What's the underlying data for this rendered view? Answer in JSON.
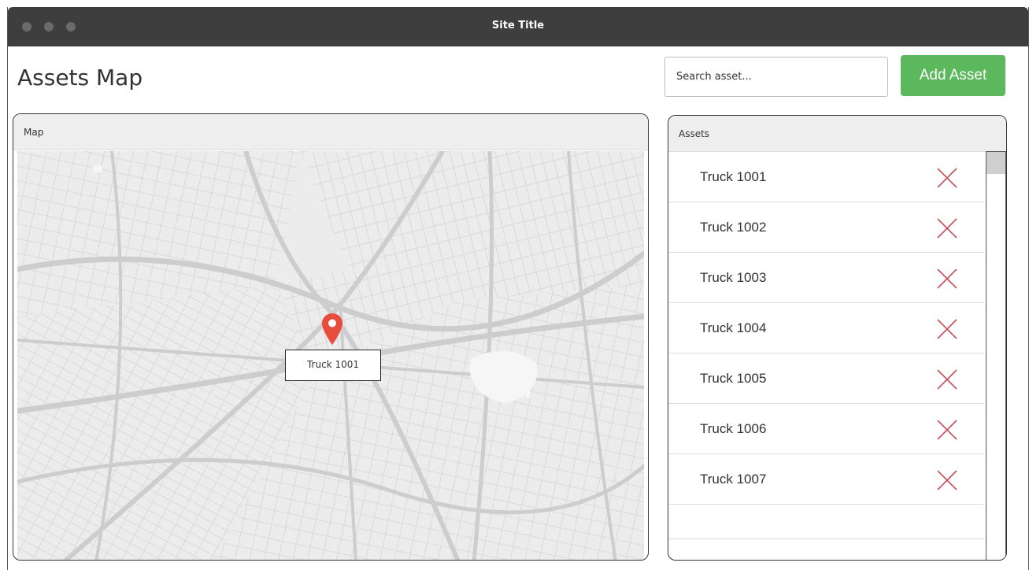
{
  "window": {
    "title": "Site Title"
  },
  "page": {
    "title": "Assets Map"
  },
  "search": {
    "placeholder": "Search asset..."
  },
  "toolbar": {
    "add_label": "Add Asset",
    "add_color": "#5cb85c"
  },
  "map_panel": {
    "header": "Map",
    "marker_label": "Truck 1001",
    "marker_color": "#e74c3c"
  },
  "assets_panel": {
    "header": "Assets",
    "items": [
      {
        "label": "Truck 1001"
      },
      {
        "label": "Truck 1002"
      },
      {
        "label": "Truck 1003"
      },
      {
        "label": "Truck 1004"
      },
      {
        "label": "Truck 1005"
      },
      {
        "label": "Truck 1006"
      },
      {
        "label": "Truck 1007"
      }
    ],
    "remove_icon": "close-icon",
    "remove_color": "#c9505a"
  }
}
